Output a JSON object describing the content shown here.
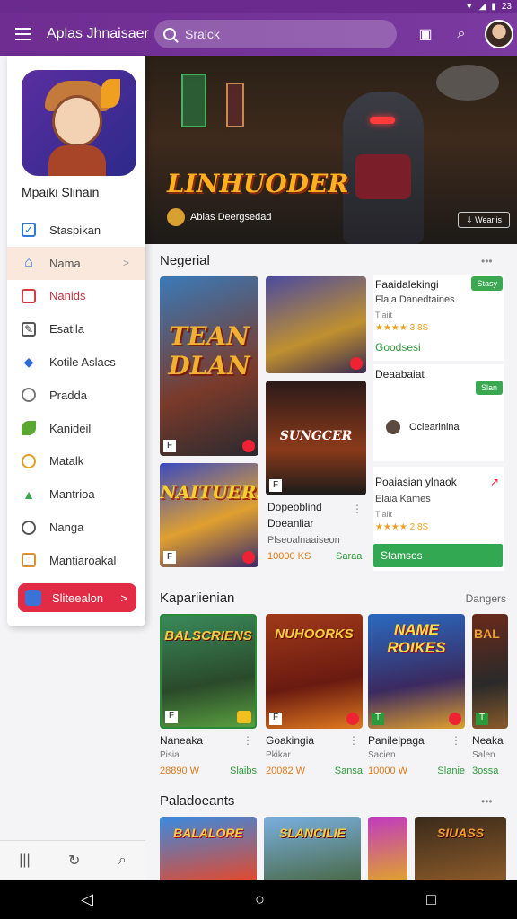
{
  "status": {
    "time": "23"
  },
  "appbar": {
    "title": "Aplas Jhnaisaer",
    "search_placeholder": "Sraick"
  },
  "drawer": {
    "profile_name": "Mpaiki Slinain",
    "items": [
      {
        "label": "Staspikan",
        "icon": "checkbox-icon",
        "color": "#2a7ad8"
      },
      {
        "label": "Nama",
        "icon": "home-icon",
        "color": "#2a7ad8",
        "active": true
      },
      {
        "label": "Nanids",
        "icon": "square-icon",
        "color": "#d23a4a"
      },
      {
        "label": "Esatila",
        "icon": "edit-icon",
        "color": "#555555"
      },
      {
        "label": "Kotile Aslacs",
        "icon": "diamond-icon",
        "color": "#2a6ad8"
      },
      {
        "label": "Pradda",
        "icon": "target-icon",
        "color": "#777777"
      },
      {
        "label": "Kanideil",
        "icon": "leaf-icon",
        "color": "#5aa830"
      },
      {
        "label": "Matalk",
        "icon": "circle-icon",
        "color": "#e0a020"
      },
      {
        "label": "Mantrioa",
        "icon": "thumb-icon",
        "color": "#3aa850"
      },
      {
        "label": "Nanga",
        "icon": "clock-icon",
        "color": "#555555"
      },
      {
        "label": "Mantiaroakal",
        "icon": "box-icon",
        "color": "#d89030"
      }
    ],
    "button_label": "Sliteealon"
  },
  "hero": {
    "title": "LINHUODER",
    "subtitle": "Abias Deergsedad",
    "button": "Wearlis"
  },
  "section1": {
    "title": "Negerial",
    "card_art_texts": [
      "TEAN DLAN",
      "SUNGCER",
      "NAITUERS"
    ],
    "list": [
      {
        "title": "Faaidalekingi",
        "sub": "Flaia Danedtaines",
        "sub2": "Tlaiit",
        "stars": "★★★★ 3 8S",
        "pill": "Stasy",
        "link": "Goodsesi"
      },
      {
        "title": "Deaabaiat",
        "pill": "Slan",
        "user": "Oclearinina"
      },
      {
        "title": "Poaiasian ylnaok",
        "sub": "Elaia Kames",
        "sub2": "Tlaiit",
        "stars": "★★★★ 2 8S",
        "button": "Stamsos"
      }
    ],
    "mid_card": {
      "title": "Dopeoblind",
      "sub": "Doeanliar",
      "desc": "Plseoalnaaiseon",
      "price_a": "10000 KS",
      "price_b": "Saraa"
    }
  },
  "section2": {
    "title": "Kapariienian",
    "link": "Dangers",
    "tiles": [
      {
        "art": "BALSCRIENS",
        "name": "Naneaka",
        "sub": "Pisia",
        "price_a": "28890 W",
        "price_b": "Slaibs"
      },
      {
        "art": "NUHOORKS",
        "name": "Goakingia",
        "sub": "Pkikar",
        "price_a": "20082 W",
        "price_b": "Sansa"
      },
      {
        "art": "NAME ROIKES",
        "name": "Panilelpaga",
        "sub": "Sacien",
        "price_a": "10000 W",
        "price_b": "Slanie"
      },
      {
        "art": "BAL",
        "name": "Neaka",
        "sub": "Salen",
        "price_a": "3ossa",
        "price_b": ""
      }
    ]
  },
  "section3": {
    "title": "Paladoeants",
    "strip_texts": [
      "BALALORE",
      "SLANCILIE",
      "",
      "SIUASS"
    ]
  },
  "colors": {
    "primary": "#6f2c91",
    "accent_red": "#e22c45",
    "accent_green": "#32a852"
  }
}
